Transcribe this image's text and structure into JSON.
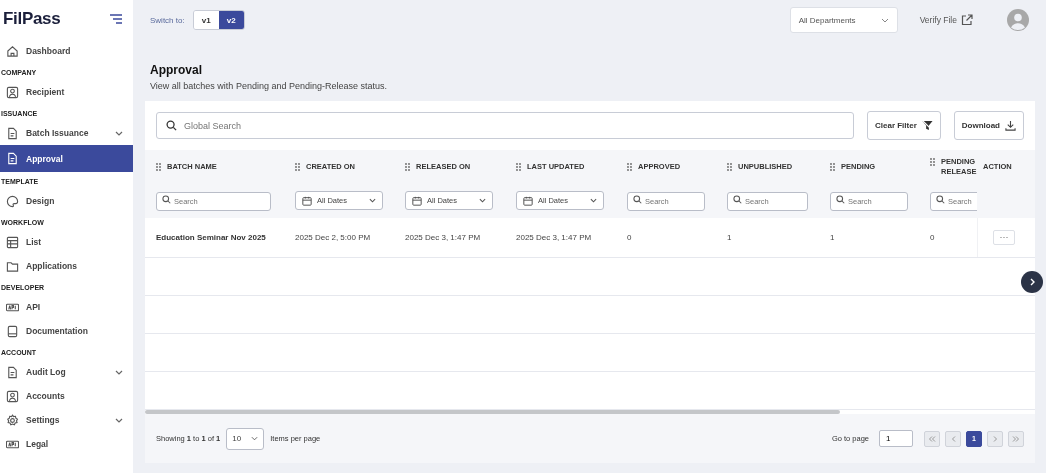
{
  "brand": {
    "name": "FilPass"
  },
  "sidebar": {
    "items": [
      {
        "kind": "item",
        "label": "Dashboard",
        "selected": false,
        "expandable": false
      },
      {
        "kind": "section",
        "label": "COMPANY"
      },
      {
        "kind": "item",
        "label": "Recipient",
        "selected": false,
        "expandable": false
      },
      {
        "kind": "section",
        "label": "ISSUANCE"
      },
      {
        "kind": "item",
        "label": "Batch Issuance",
        "selected": false,
        "expandable": true
      },
      {
        "kind": "item",
        "label": "Approval",
        "selected": true,
        "expandable": false
      },
      {
        "kind": "section",
        "label": "TEMPLATE"
      },
      {
        "kind": "item",
        "label": "Design",
        "selected": false,
        "expandable": false
      },
      {
        "kind": "section",
        "label": "WORKFLOW"
      },
      {
        "kind": "item",
        "label": "List",
        "selected": false,
        "expandable": false
      },
      {
        "kind": "item",
        "label": "Applications",
        "selected": false,
        "expandable": false
      },
      {
        "kind": "section",
        "label": "DEVELOPER"
      },
      {
        "kind": "item",
        "label": "API",
        "selected": false,
        "expandable": false
      },
      {
        "kind": "item",
        "label": "Documentation",
        "selected": false,
        "expandable": false
      },
      {
        "kind": "section",
        "label": "ACCOUNT"
      },
      {
        "kind": "item",
        "label": "Audit Log",
        "selected": false,
        "expandable": true
      },
      {
        "kind": "item",
        "label": "Accounts",
        "selected": false,
        "expandable": false
      },
      {
        "kind": "item",
        "label": "Settings",
        "selected": false,
        "expandable": true
      },
      {
        "kind": "item",
        "label": "Legal",
        "selected": false,
        "expandable": false
      }
    ]
  },
  "topbar": {
    "switch_label": "Switch to:",
    "versions": [
      {
        "label": "v1",
        "selected": false
      },
      {
        "label": "v2",
        "selected": true
      }
    ],
    "department": "All Departments",
    "verify": "Verify File"
  },
  "page": {
    "title": "Approval",
    "subtitle": "View all batches with Pending and Pending-Release status."
  },
  "toolbar": {
    "search_placeholder": "Global Search",
    "clear": "Clear Filter",
    "download": "Download"
  },
  "table": {
    "columns": [
      {
        "label": "BATCH NAME",
        "kind": "search",
        "placeholder": "Search"
      },
      {
        "label": "CREATED ON",
        "kind": "date",
        "value": "All Dates"
      },
      {
        "label": "RELEASED ON",
        "kind": "date",
        "value": "All Dates"
      },
      {
        "label": "LAST UPDATED",
        "kind": "date",
        "value": "All Dates"
      },
      {
        "label": "APPROVED",
        "kind": "search",
        "placeholder": "Search"
      },
      {
        "label": "UNPUBLISHED",
        "kind": "search",
        "placeholder": "Search"
      },
      {
        "label": "PENDING",
        "kind": "search",
        "placeholder": "Search"
      },
      {
        "label": "PENDING RELEASE",
        "kind": "search",
        "placeholder": "Search"
      }
    ],
    "action_label": "ACTION",
    "rows": [
      [
        "Education Seminar Nov 2025",
        "2025 Dec 2, 5:00 PM",
        "2025 Dec 3, 1:47 PM",
        "2025 Dec 3, 1:47 PM",
        "0",
        "1",
        "1",
        "0"
      ]
    ],
    "action_button": "···"
  },
  "footer": {
    "showing": "Showing **1** to **1** of **1**",
    "per_page": "10",
    "per_page_label": "Items per page",
    "goto_label": "Go to page",
    "goto_value": "1",
    "pages": [
      {
        "label": "1",
        "selected": true
      }
    ]
  }
}
